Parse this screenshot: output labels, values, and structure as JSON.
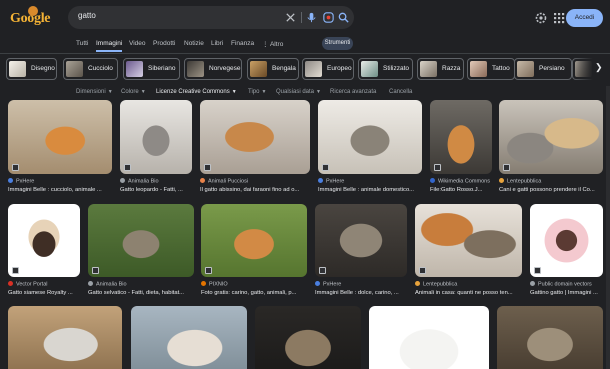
{
  "header": {
    "logo_text": "Google",
    "search_query": "gatto",
    "login_label": "Accedi",
    "icons": [
      "clear-icon",
      "microphone-icon",
      "lens-icon",
      "search-icon",
      "settings-icon",
      "apps-icon"
    ]
  },
  "tabs": {
    "items": [
      "Tutti",
      "Immagini",
      "Video",
      "Prodotti",
      "Notizie",
      "Libri",
      "Finanza",
      "⋮ Altro"
    ],
    "active": "Immagini",
    "tools_label": "Strumenti"
  },
  "chips": [
    "Disegno",
    "Cucciolo",
    "Siberiano",
    "Norvegese",
    "Bengala",
    "Europeo",
    "Stilizzato",
    "Razza",
    "Tattoo",
    "Persiano"
  ],
  "filters": {
    "items": [
      "Dimensioni",
      "Colore",
      "Licenze Creative Commons",
      "Tipo",
      "Qualsiasi data"
    ],
    "advanced": "Ricerca avanzata",
    "clear": "Cancella"
  },
  "results": [
    {
      "source": "PxHere",
      "title": "Immagini Belle : cucciolo, animale ..."
    },
    {
      "source": "Animalia Bio",
      "title": "Gatto leopardo - Fatti, ..."
    },
    {
      "source": "Animali Pucciosi",
      "title": "Il gatto abissino, dai faraoni fino ad o..."
    },
    {
      "source": "PxHere",
      "title": "Immagini Belle : animale domestico..."
    },
    {
      "source": "Wikimedia Commons",
      "title": "File:Gatto Rosso.J..."
    },
    {
      "source": "Lentepubblica",
      "title": "Cani e gatti possono prendere il Co..."
    },
    {
      "source": "Vector Portal",
      "title": "Gatto siamese Royalty ..."
    },
    {
      "source": "Animalia Bio",
      "title": "Gatto selvatico - Fatti, dieta, habitat..."
    },
    {
      "source": "PIXNIO",
      "title": "Foto gratis: carino, gatto, animali, p..."
    },
    {
      "source": "PxHere",
      "title": "Immagini Belle : dolce, carino, ..."
    },
    {
      "source": "Lentepubblica",
      "title": "Animali in casa: quanti ne posso ten..."
    },
    {
      "source": "Public domain vectors",
      "title": "Gattino gatto | Immagini ..."
    },
    {
      "source": "",
      "title": ""
    },
    {
      "source": "",
      "title": ""
    },
    {
      "source": "",
      "title": ""
    },
    {
      "source": "",
      "title": ""
    },
    {
      "source": "",
      "title": ""
    }
  ],
  "colors": {
    "background": "#202124",
    "accent": "#8ab4f8",
    "tools_chip": "#394457"
  }
}
